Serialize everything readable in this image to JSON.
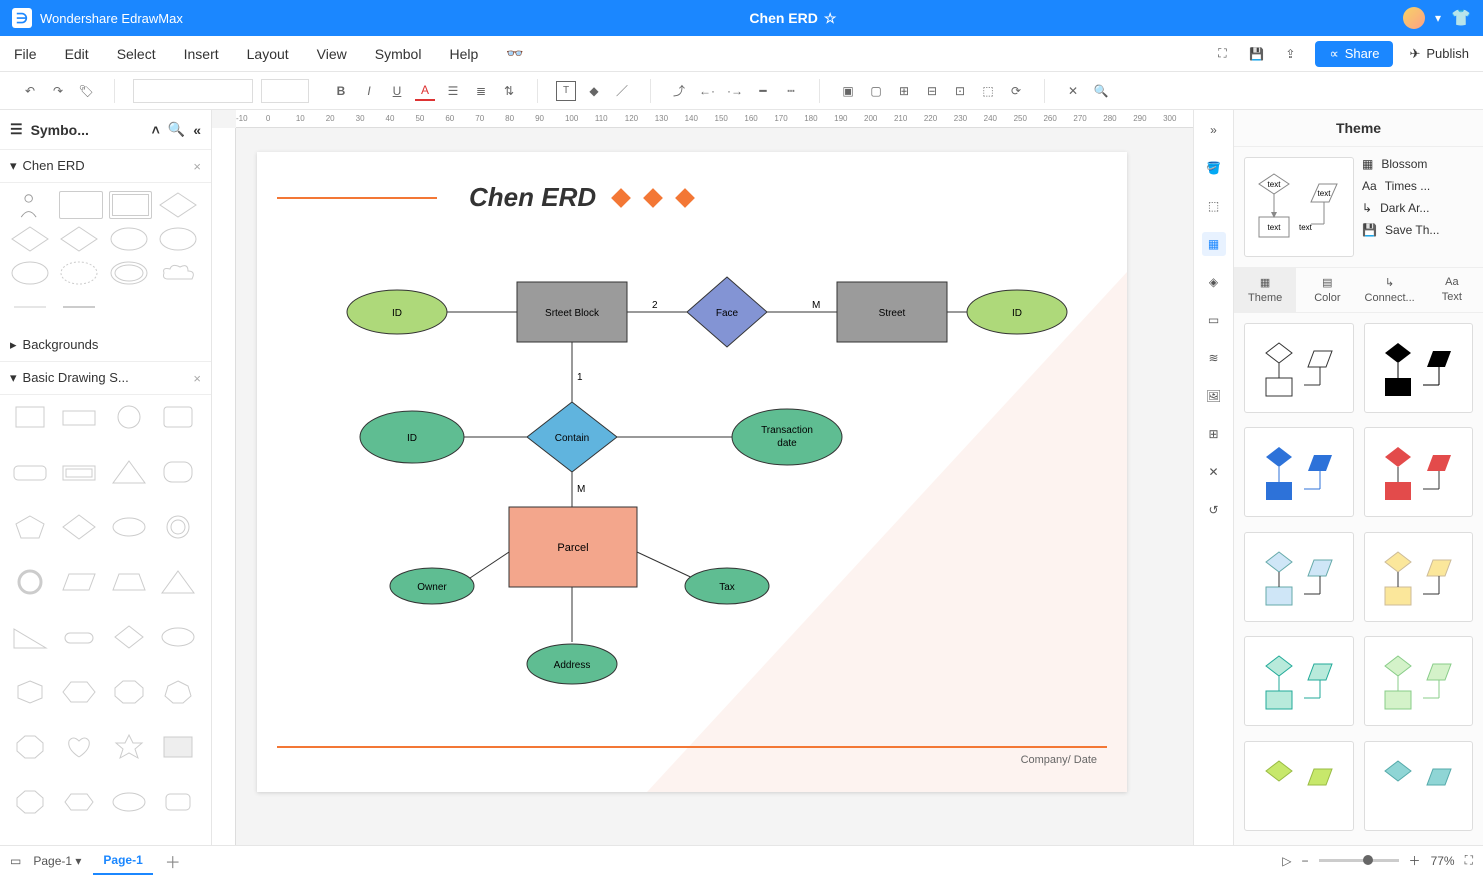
{
  "app": {
    "name": "Wondershare EdrawMax",
    "document": "Chen ERD"
  },
  "menus": {
    "file": "File",
    "edit": "Edit",
    "select": "Select",
    "insert": "Insert",
    "layout": "Layout",
    "view": "View",
    "symbol": "Symbol",
    "help": "Help"
  },
  "actions": {
    "share": "Share",
    "publish": "Publish"
  },
  "sidebar": {
    "title": "Symbo...",
    "sections": {
      "chen": "Chen ERD",
      "backgrounds": "Backgrounds",
      "basic": "Basic Drawing S..."
    }
  },
  "diagram": {
    "title": "Chen ERD",
    "nodes": {
      "id1": "ID",
      "streetblock": "Srteet Block",
      "face": "Face",
      "street": "Street",
      "id2": "ID",
      "id3": "ID",
      "contain": "Contain",
      "txdate1": "Transaction",
      "txdate2": "date",
      "parcel": "Parcel",
      "owner": "Owner",
      "tax": "Tax",
      "address": "Address"
    },
    "edge_labels": {
      "two": "2",
      "m1": "M",
      "one": "1",
      "m2": "M"
    },
    "footer": "Company/ Date"
  },
  "right_panel": {
    "title": "Theme",
    "preview": {
      "t1": "text",
      "t2": "text",
      "t3": "text",
      "t4": "text"
    },
    "props": {
      "color": "Blossom",
      "font": "Times ...",
      "connector": "Dark Ar...",
      "save": "Save Th..."
    },
    "tabs": {
      "theme": "Theme",
      "color": "Color",
      "connector": "Connect...",
      "text": "Text"
    }
  },
  "ruler": {
    "m10": "-10",
    "z": "0",
    "p10": "10",
    "p20": "20",
    "p30": "30",
    "p40": "40",
    "p50": "50",
    "p60": "60",
    "p70": "70",
    "p80": "80",
    "p90": "90",
    "p100": "100",
    "p110": "110",
    "p120": "120",
    "p130": "130",
    "p140": "140",
    "p150": "150",
    "p160": "160",
    "p170": "170",
    "p180": "180",
    "p190": "190",
    "p200": "200",
    "p210": "210",
    "p220": "220",
    "p230": "230",
    "p240": "240",
    "p250": "250",
    "p260": "260",
    "p270": "270",
    "p280": "280",
    "p290": "290",
    "p300": "300"
  },
  "status": {
    "pagesel": "Page-1",
    "pagetab": "Page-1",
    "zoom": "77%"
  }
}
